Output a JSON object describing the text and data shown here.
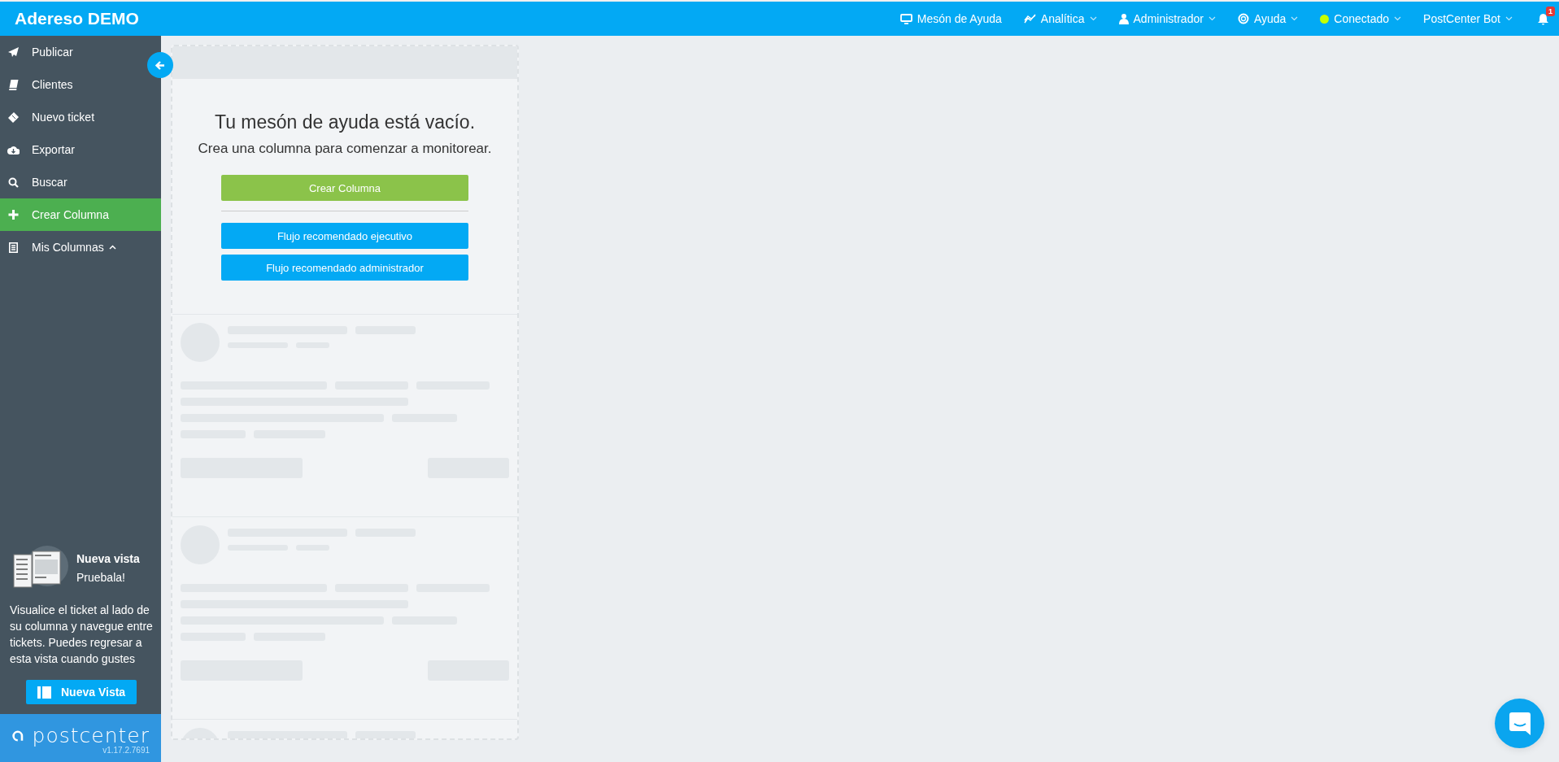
{
  "brand": "Adereso DEMO",
  "topbar": {
    "items": [
      {
        "label": "Mesón de Ayuda",
        "dropdown": false
      },
      {
        "label": "Analítica",
        "dropdown": true
      },
      {
        "label": "Administrador",
        "dropdown": true
      },
      {
        "label": "Ayuda",
        "dropdown": true
      },
      {
        "label": "Conectado",
        "dropdown": true,
        "color": "#c6ff00"
      },
      {
        "label": "PostCenter Bot",
        "dropdown": true
      }
    ],
    "notifications": "1"
  },
  "sidebar": {
    "items": [
      {
        "label": "Publicar",
        "selected": false
      },
      {
        "label": "Clientes",
        "selected": false
      },
      {
        "label": "Nuevo ticket",
        "selected": false
      },
      {
        "label": "Exportar",
        "selected": false
      },
      {
        "label": "Buscar",
        "selected": false
      },
      {
        "label": "Crear Columna",
        "selected": true
      }
    ],
    "section": {
      "label": "Mis Columnas",
      "expanded": true
    },
    "promo": {
      "title": "Nueva vista",
      "subtitle": "Pruebala!",
      "text": "Visualice el ticket al lado de su columna y navegue entre tickets. Puedes regresar a esta vista cuando gustes",
      "button": "Nueva Vista"
    },
    "footer": {
      "logo": "postcenter",
      "version": "v1.17.2.7691"
    }
  },
  "empty_state": {
    "title": "Tu mesón de ayuda está vacío.",
    "subtitle": "Crea una columna para comenzar a monitorear.",
    "primary": "Crear Columna",
    "flows": [
      "Flujo recomendado ejecutivo",
      "Flujo recomendado administrador"
    ]
  }
}
